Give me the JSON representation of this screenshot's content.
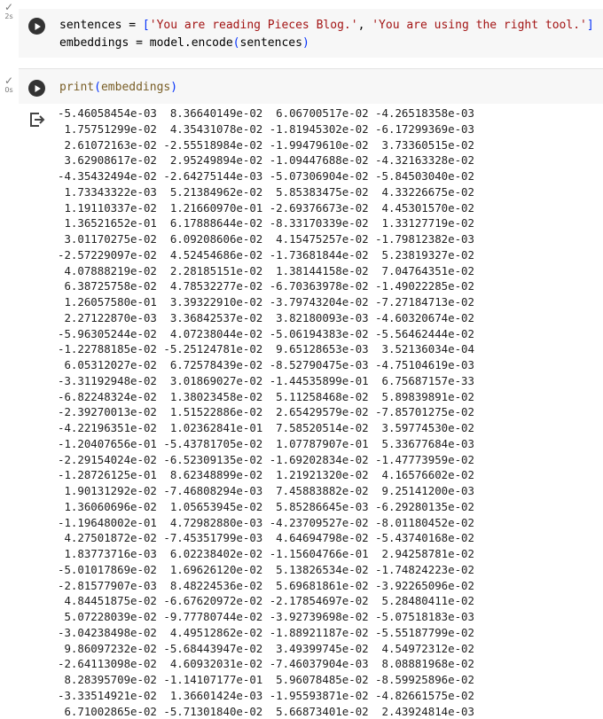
{
  "cells": [
    {
      "status": {
        "icon": "checkmark-icon",
        "time": "2s"
      },
      "run_icon": "play-circle-icon",
      "code": {
        "line1": {
          "var": "sentences = ",
          "open": "[",
          "s1": "'You are reading Pieces Blog.'",
          "sep": ", ",
          "s2": "'You are using the right tool.'",
          "close": "]"
        },
        "line2": {
          "pre": "embeddings = model.encode",
          "open": "(",
          "arg": "sentences",
          "close": ")"
        }
      }
    },
    {
      "status": {
        "icon": "checkmark-icon",
        "time": "0s"
      },
      "run_icon": "play-circle-icon",
      "code": {
        "line1": {
          "fn": "print",
          "open": "(",
          "arg": "embeddings",
          "close": ")"
        }
      },
      "output_icon": "output-arrow-icon",
      "output_rows": [
        [
          "-5.46058454e-03",
          "8.36640149e-02",
          "6.06700517e-02",
          "-4.26518358e-03"
        ],
        [
          "1.75751299e-02",
          "4.35431078e-02",
          "-1.81945302e-02",
          "-6.17299369e-03"
        ],
        [
          "2.61072163e-02",
          "-2.55518984e-02",
          "-1.99479610e-02",
          "3.73360515e-02"
        ],
        [
          "3.62908617e-02",
          "2.95249894e-02",
          "-1.09447688e-02",
          "-4.32163328e-02"
        ],
        [
          "-4.35432494e-02",
          "-2.64275144e-03",
          "-5.07306904e-02",
          "-5.84503040e-02"
        ],
        [
          "1.73343322e-03",
          "5.21384962e-02",
          "5.85383475e-02",
          "4.33226675e-02"
        ],
        [
          "1.19110337e-02",
          "1.21660970e-01",
          "-2.69376673e-02",
          "4.45301570e-02"
        ],
        [
          "1.36521652e-01",
          "6.17888644e-02",
          "-8.33170339e-02",
          "1.33127719e-02"
        ],
        [
          "3.01170275e-02",
          "6.09208606e-02",
          "4.15475257e-02",
          "-1.79812382e-03"
        ],
        [
          "-2.57229097e-02",
          "4.52454686e-02",
          "-1.73681844e-02",
          "5.23819327e-02"
        ],
        [
          "4.07888219e-02",
          "2.28185151e-02",
          "1.38144158e-02",
          "7.04764351e-02"
        ],
        [
          "6.38725758e-02",
          "4.78532277e-02",
          "-6.70363978e-02",
          "-1.49022285e-02"
        ],
        [
          "1.26057580e-01",
          "3.39322910e-02",
          "-3.79743204e-02",
          "-7.27184713e-02"
        ],
        [
          "2.27122870e-03",
          "3.36842537e-02",
          "3.82180093e-03",
          "-4.60320674e-02"
        ],
        [
          "-5.96305244e-02",
          "4.07238044e-02",
          "-5.06194383e-02",
          "-5.56462444e-02"
        ],
        [
          "-1.22788185e-02",
          "-5.25124781e-02",
          "9.65128653e-03",
          "3.52136034e-04"
        ],
        [
          "6.05312027e-02",
          "6.72578439e-02",
          "-8.52790475e-03",
          "-4.75104619e-03"
        ],
        [
          "-3.31192948e-02",
          "3.01869027e-02",
          "-1.44535899e-01",
          "6.75687157e-33"
        ],
        [
          "-6.82248324e-02",
          "1.38023458e-02",
          "5.11258468e-02",
          "5.89839891e-02"
        ],
        [
          "-2.39270013e-02",
          "1.51522886e-02",
          "2.65429579e-02",
          "-7.85701275e-02"
        ],
        [
          "-4.22196351e-02",
          "1.02362841e-01",
          "7.58520514e-02",
          "3.59774530e-02"
        ],
        [
          "-1.20407656e-01",
          "-5.43781705e-02",
          "1.07787907e-01",
          "5.33677684e-03"
        ],
        [
          "-2.29154024e-02",
          "-6.52309135e-02",
          "-1.69202834e-02",
          "-1.47773959e-02"
        ],
        [
          "-1.28726125e-01",
          "8.62348899e-02",
          "1.21921320e-02",
          "4.16576602e-02"
        ],
        [
          "1.90131292e-02",
          "-7.46808294e-03",
          "7.45883882e-02",
          "9.25141200e-03"
        ],
        [
          "1.36060696e-02",
          "1.05653945e-02",
          "5.85286645e-03",
          "-6.29280135e-02"
        ],
        [
          "-1.19648002e-01",
          "4.72982880e-03",
          "-4.23709527e-02",
          "-8.01180452e-02"
        ],
        [
          "4.27501872e-02",
          "-7.45351799e-03",
          "4.64694798e-02",
          "-5.43740168e-02"
        ],
        [
          "1.83773716e-03",
          "6.02238402e-02",
          "-1.15604766e-01",
          "2.94258781e-02"
        ],
        [
          "-5.01017869e-02",
          "1.69626120e-02",
          "5.13826534e-02",
          "-1.74824223e-02"
        ],
        [
          "-2.81577907e-03",
          "8.48224536e-02",
          "5.69681861e-02",
          "-3.92265096e-02"
        ],
        [
          "4.84451875e-02",
          "-6.67620972e-02",
          "-2.17854697e-02",
          "5.28480411e-02"
        ],
        [
          "5.07228039e-02",
          "-9.77780744e-02",
          "-3.92739698e-02",
          "-5.07518183e-03"
        ],
        [
          "-3.04238498e-02",
          "4.49512862e-02",
          "-1.88921187e-02",
          "-5.55187799e-02"
        ],
        [
          "9.86097232e-02",
          "-5.68443947e-02",
          "3.49399745e-02",
          "4.54972312e-02"
        ],
        [
          "-2.64113098e-02",
          "4.60932031e-02",
          "-7.46037904e-03",
          "8.08881968e-02"
        ],
        [
          "8.28395709e-02",
          "-1.14107177e-01",
          "5.96078485e-02",
          "-8.59925896e-02"
        ],
        [
          "-3.33514921e-02",
          "1.36601424e-03",
          "-1.95593871e-02",
          "-4.82661575e-02"
        ],
        [
          "6.71002865e-02",
          "-5.71301840e-02",
          "5.66873401e-02",
          "2.43924814e-03"
        ]
      ]
    }
  ]
}
